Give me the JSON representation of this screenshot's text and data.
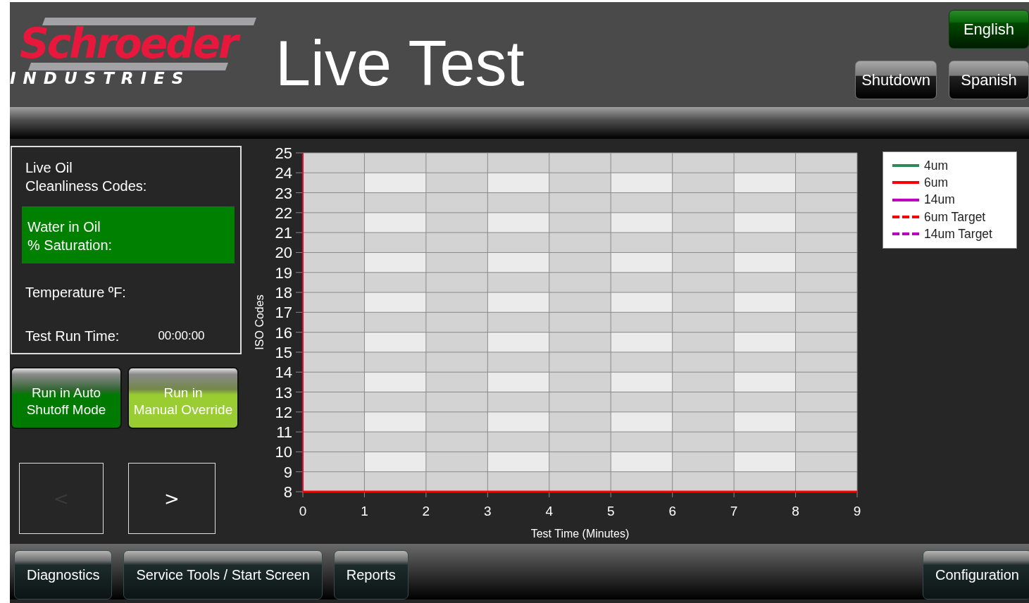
{
  "header": {
    "logo": {
      "name": "Schroeder",
      "tagline": "INDUSTRIES"
    },
    "title": "Live Test",
    "languages": [
      {
        "label": "English",
        "selected": true
      },
      {
        "label": "Spanish",
        "selected": false
      }
    ],
    "shutdown": "Shutdown"
  },
  "readings": [
    {
      "label": "Live Oil\nCleanliness Codes:",
      "highlighted": false
    },
    {
      "label": "Water in Oil\n% Saturation:",
      "highlighted": true
    },
    {
      "label": "Temperature ºF:",
      "highlighted": false
    },
    {
      "label": "Test Run Time:",
      "value": "00:00:00",
      "highlighted": false
    }
  ],
  "mode_buttons": [
    {
      "label": "Run in Auto\nShutoff Mode",
      "color": "#007a00"
    },
    {
      "label": "Run in\nManual Override",
      "color": "#9acd32"
    }
  ],
  "nav_buttons": [
    {
      "label": "<",
      "disabled": true
    },
    {
      "label": ">",
      "disabled": false
    }
  ],
  "chart": {
    "chart_data": {
      "type": "line",
      "xlabel": "Test Time (Minutes)",
      "ylabel": "ISO Codes",
      "grid": true,
      "categories": [
        "0",
        "1",
        "2",
        "3",
        "4",
        "5",
        "6",
        "7",
        "8",
        "9"
      ],
      "ylim": [
        8,
        25
      ],
      "yticks": [
        8,
        9,
        10,
        11,
        12,
        13,
        14,
        15,
        16,
        17,
        18,
        19,
        20,
        21,
        22,
        23,
        24,
        25
      ],
      "series": [
        {
          "name": "4um",
          "color": "#2e8b57",
          "values": [
            null,
            null,
            null,
            null,
            null,
            null,
            null,
            null,
            null,
            null
          ]
        },
        {
          "name": "6um",
          "color": "#ff0000",
          "values": [
            8,
            8,
            8,
            8,
            8,
            8,
            8,
            8,
            8,
            8
          ]
        },
        {
          "name": "14um",
          "color": "#c000c0",
          "values": [
            null,
            null,
            null,
            null,
            null,
            null,
            null,
            null,
            null,
            null
          ]
        },
        {
          "name": "6um Target",
          "color": "#ff0000",
          "values": [
            null,
            null,
            null,
            null,
            null,
            null,
            null,
            null,
            null,
            null
          ]
        },
        {
          "name": "14um Target",
          "color": "#c000c0",
          "values": [
            null,
            null,
            null,
            null,
            null,
            null,
            null,
            null,
            null,
            null
          ]
        }
      ]
    },
    "legend_lines": [
      {
        "dashed": false
      },
      {
        "dashed": false
      },
      {
        "dashed": false
      },
      {
        "dashed": true
      },
      {
        "dashed": true
      }
    ]
  },
  "footer": {
    "left_buttons": [
      "Diagnostics",
      "Service Tools / Start Screen",
      "Reports"
    ],
    "right_buttons": [
      "Configuration"
    ]
  }
}
